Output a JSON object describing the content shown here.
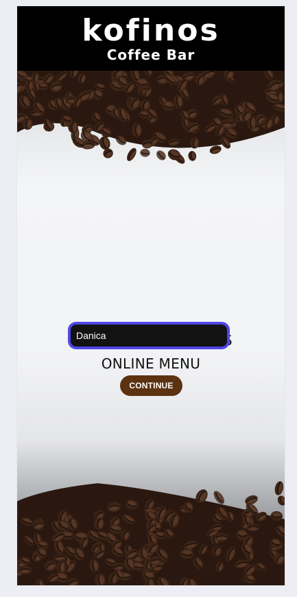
{
  "header": {
    "logo_word": "kofinos",
    "logo_subtitle": "Coffee Bar"
  },
  "main": {
    "welcome_line1": "WELCOME TO KOFINOS",
    "welcome_line2": "ONLINE MENU",
    "name_input": {
      "value": "Danica",
      "placeholder": ""
    },
    "continue_label": "CONTINUE"
  },
  "colors": {
    "header_bg": "#000000",
    "input_border": "#4f46e5",
    "input_bg": "#121212",
    "button_bg": "#5c3210",
    "bean": "#3b2417"
  },
  "icons": [
    "coffee-bean-icon"
  ]
}
